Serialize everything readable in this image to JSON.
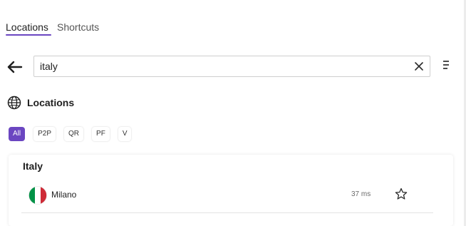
{
  "tabs": [
    {
      "label": "Locations",
      "active": true
    },
    {
      "label": "Shortcuts",
      "active": false
    }
  ],
  "search": {
    "value": "italy",
    "back_icon": "arrow-left-icon",
    "clear_icon": "close-icon",
    "menu_icon": "menu-icon"
  },
  "section": {
    "icon": "globe-icon",
    "title": "Locations"
  },
  "filters": [
    {
      "label": "All",
      "active": true
    },
    {
      "label": "P2P",
      "active": false
    },
    {
      "label": "QR",
      "active": false
    },
    {
      "label": "PF",
      "active": false
    },
    {
      "label": "V",
      "active": false
    }
  ],
  "results": {
    "group_title": "Italy",
    "items": [
      {
        "flag_icon": "italy-flag-icon",
        "city": "Milano",
        "latency": "37 ms",
        "star_icon": "star-icon"
      }
    ]
  },
  "colors": {
    "accent": "#6b46c1",
    "italy_green": "#009246",
    "italy_white": "#ffffff",
    "italy_red": "#ce2b37"
  }
}
